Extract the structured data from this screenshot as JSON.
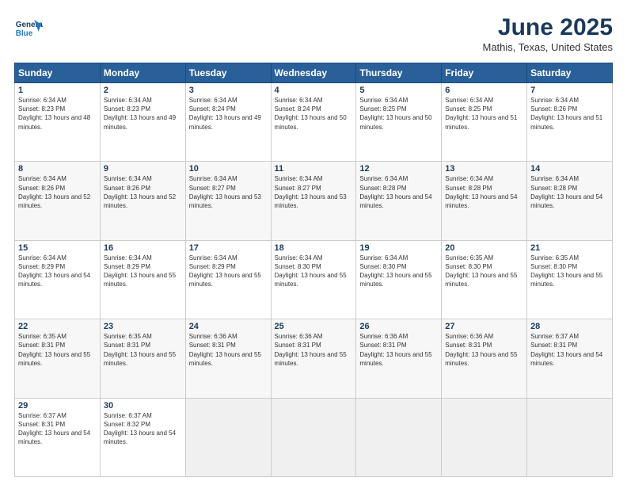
{
  "header": {
    "logo_line1": "General",
    "logo_line2": "Blue",
    "month": "June 2025",
    "location": "Mathis, Texas, United States"
  },
  "weekdays": [
    "Sunday",
    "Monday",
    "Tuesday",
    "Wednesday",
    "Thursday",
    "Friday",
    "Saturday"
  ],
  "weeks": [
    [
      {
        "day": "1",
        "sr": "6:34 AM",
        "ss": "8:23 PM",
        "dl": "13 hours and 48 minutes."
      },
      {
        "day": "2",
        "sr": "6:34 AM",
        "ss": "8:23 PM",
        "dl": "13 hours and 49 minutes."
      },
      {
        "day": "3",
        "sr": "6:34 AM",
        "ss": "8:24 PM",
        "dl": "13 hours and 49 minutes."
      },
      {
        "day": "4",
        "sr": "6:34 AM",
        "ss": "8:24 PM",
        "dl": "13 hours and 50 minutes."
      },
      {
        "day": "5",
        "sr": "6:34 AM",
        "ss": "8:25 PM",
        "dl": "13 hours and 50 minutes."
      },
      {
        "day": "6",
        "sr": "6:34 AM",
        "ss": "8:25 PM",
        "dl": "13 hours and 51 minutes."
      },
      {
        "day": "7",
        "sr": "6:34 AM",
        "ss": "8:26 PM",
        "dl": "13 hours and 51 minutes."
      }
    ],
    [
      {
        "day": "8",
        "sr": "6:34 AM",
        "ss": "8:26 PM",
        "dl": "13 hours and 52 minutes."
      },
      {
        "day": "9",
        "sr": "6:34 AM",
        "ss": "8:26 PM",
        "dl": "13 hours and 52 minutes."
      },
      {
        "day": "10",
        "sr": "6:34 AM",
        "ss": "8:27 PM",
        "dl": "13 hours and 53 minutes."
      },
      {
        "day": "11",
        "sr": "6:34 AM",
        "ss": "8:27 PM",
        "dl": "13 hours and 53 minutes."
      },
      {
        "day": "12",
        "sr": "6:34 AM",
        "ss": "8:28 PM",
        "dl": "13 hours and 54 minutes."
      },
      {
        "day": "13",
        "sr": "6:34 AM",
        "ss": "8:28 PM",
        "dl": "13 hours and 54 minutes."
      },
      {
        "day": "14",
        "sr": "6:34 AM",
        "ss": "8:28 PM",
        "dl": "13 hours and 54 minutes."
      }
    ],
    [
      {
        "day": "15",
        "sr": "6:34 AM",
        "ss": "8:29 PM",
        "dl": "13 hours and 54 minutes."
      },
      {
        "day": "16",
        "sr": "6:34 AM",
        "ss": "8:29 PM",
        "dl": "13 hours and 55 minutes."
      },
      {
        "day": "17",
        "sr": "6:34 AM",
        "ss": "8:29 PM",
        "dl": "13 hours and 55 minutes."
      },
      {
        "day": "18",
        "sr": "6:34 AM",
        "ss": "8:30 PM",
        "dl": "13 hours and 55 minutes."
      },
      {
        "day": "19",
        "sr": "6:34 AM",
        "ss": "8:30 PM",
        "dl": "13 hours and 55 minutes."
      },
      {
        "day": "20",
        "sr": "6:35 AM",
        "ss": "8:30 PM",
        "dl": "13 hours and 55 minutes."
      },
      {
        "day": "21",
        "sr": "6:35 AM",
        "ss": "8:30 PM",
        "dl": "13 hours and 55 minutes."
      }
    ],
    [
      {
        "day": "22",
        "sr": "6:35 AM",
        "ss": "8:31 PM",
        "dl": "13 hours and 55 minutes."
      },
      {
        "day": "23",
        "sr": "6:35 AM",
        "ss": "8:31 PM",
        "dl": "13 hours and 55 minutes."
      },
      {
        "day": "24",
        "sr": "6:36 AM",
        "ss": "8:31 PM",
        "dl": "13 hours and 55 minutes."
      },
      {
        "day": "25",
        "sr": "6:36 AM",
        "ss": "8:31 PM",
        "dl": "13 hours and 55 minutes."
      },
      {
        "day": "26",
        "sr": "6:36 AM",
        "ss": "8:31 PM",
        "dl": "13 hours and 55 minutes."
      },
      {
        "day": "27",
        "sr": "6:36 AM",
        "ss": "8:31 PM",
        "dl": "13 hours and 55 minutes."
      },
      {
        "day": "28",
        "sr": "6:37 AM",
        "ss": "8:31 PM",
        "dl": "13 hours and 54 minutes."
      }
    ],
    [
      {
        "day": "29",
        "sr": "6:37 AM",
        "ss": "8:31 PM",
        "dl": "13 hours and 54 minutes."
      },
      {
        "day": "30",
        "sr": "6:37 AM",
        "ss": "8:32 PM",
        "dl": "13 hours and 54 minutes."
      },
      null,
      null,
      null,
      null,
      null
    ]
  ]
}
